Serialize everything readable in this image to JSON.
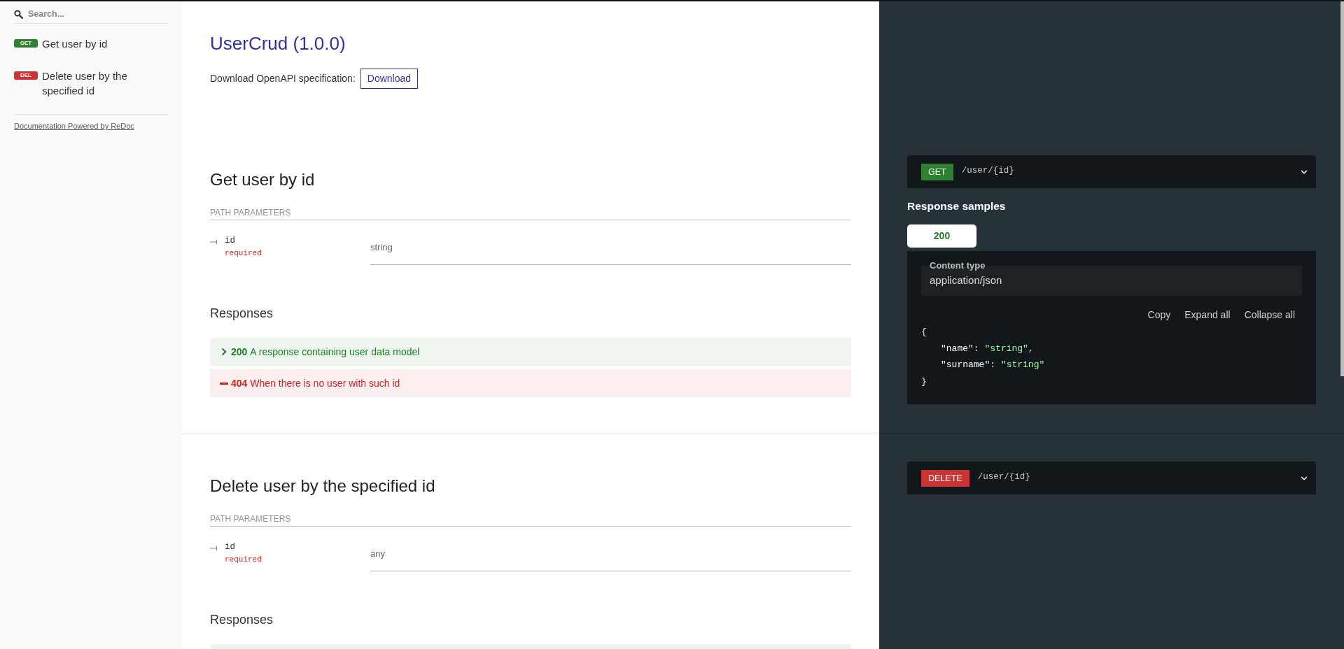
{
  "sidebar": {
    "search": {
      "placeholder": "Search..."
    },
    "items": [
      {
        "kind": "get",
        "badge": "GET",
        "label": "Get user by id",
        "selected": false
      },
      {
        "kind": "delete",
        "badge": "DEL",
        "label": "Delete user by the specified id",
        "selected": false
      }
    ],
    "footer_link": "Documentation Powered by ReDoc"
  },
  "info": {
    "title": "UserCrud (1.0.0)",
    "download_label": "Download OpenAPI specification:",
    "download_button": "Download"
  },
  "operations": [
    {
      "title": "Get user by id",
      "params_heading": "PATH PARAMETERS",
      "params": [
        {
          "name": "id",
          "flag": "required",
          "type": "string"
        }
      ],
      "responses_heading": "Responses",
      "responses": [
        {
          "kind": "success",
          "expandable": true,
          "code": "200",
          "description": "A response containing user data model"
        },
        {
          "kind": "error",
          "expandable": false,
          "code": "404",
          "description": "When there is no user with such id"
        }
      ],
      "endpoint": {
        "kind": "get",
        "method": "GET",
        "path": "/user/{id}",
        "expanded": false
      },
      "samples": {
        "heading": "Response samples",
        "tabs": [
          {
            "kind": "success",
            "label": "200",
            "selected": true
          }
        ],
        "content_type_label": "Content type",
        "content_type": "application/json",
        "actions": [
          "Copy",
          "Expand all",
          "Collapse all"
        ],
        "body": {
          "open": "{",
          "entries": [
            [
              {
                "kind": "key",
                "text": "\"name\""
              },
              {
                "kind": "punct",
                "text": ": "
              },
              {
                "kind": "string",
                "text": "\"string\""
              },
              {
                "kind": "punct",
                "text": ","
              }
            ],
            [
              {
                "kind": "key",
                "text": "\"surname\""
              },
              {
                "kind": "punct",
                "text": ": "
              },
              {
                "kind": "string",
                "text": "\"string\""
              }
            ]
          ],
          "close": "}"
        }
      }
    },
    {
      "title": "Delete user by the specified id",
      "params_heading": "PATH PARAMETERS",
      "params": [
        {
          "name": "id",
          "flag": "required",
          "type": "any"
        }
      ],
      "responses_heading": "Responses",
      "responses": [
        {
          "kind": "success"
        }
      ],
      "endpoint": {
        "kind": "delete",
        "method": "DELETE",
        "path": "/user/{id}",
        "expanded": false
      }
    }
  ]
}
